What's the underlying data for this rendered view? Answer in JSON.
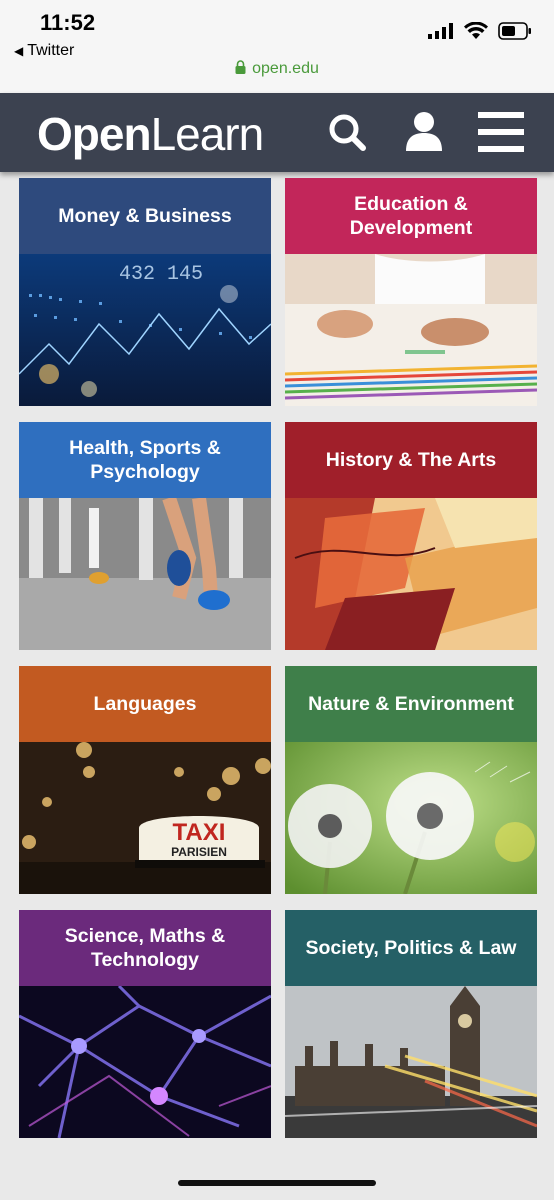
{
  "status_bar": {
    "time": "11:52",
    "back_app": "Twitter",
    "url": "open.edu"
  },
  "header": {
    "logo_bold": "Open",
    "logo_light": "Learn",
    "icons": [
      "search-icon",
      "user-icon",
      "menu-icon"
    ]
  },
  "categories": [
    {
      "label": "Money & Business",
      "color": "#2e4a7d"
    },
    {
      "label": "Education & Development",
      "color": "#c2265a"
    },
    {
      "label": "Health, Sports & Psychology",
      "color": "#2f6fbf"
    },
    {
      "label": "History & The Arts",
      "color": "#a01f2a"
    },
    {
      "label": "Languages",
      "color": "#c25a21"
    },
    {
      "label": "Nature & Environment",
      "color": "#3f7f4a"
    },
    {
      "label": "Science, Maths & Technology",
      "color": "#6b2a7c"
    },
    {
      "label": "Society, Politics & Law",
      "color": "#256066"
    }
  ],
  "image_text": {
    "taxi": "TAXI",
    "parisien": "PARISIEN"
  }
}
